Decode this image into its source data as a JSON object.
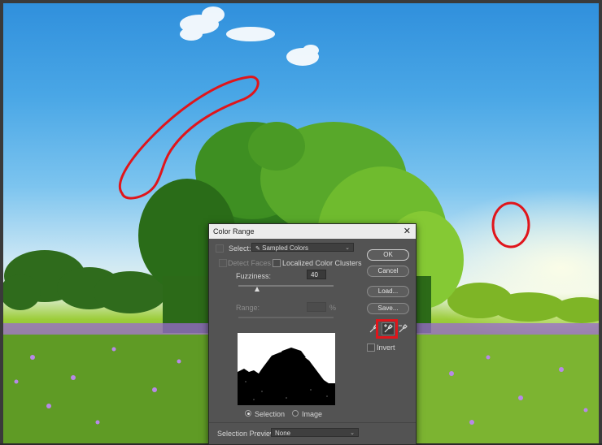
{
  "dialog": {
    "title": "Color Range",
    "close_glyph": "✕",
    "select_label": "Select:",
    "select_value": "Sampled Colors",
    "detect_faces_label": "Detect Faces",
    "localized_clusters_label": "Localized Color Clusters",
    "fuzziness_label": "Fuzziness:",
    "fuzziness_value": "40",
    "fuzziness_level": 0.2,
    "range_label": "Range:",
    "range_unit": "%",
    "selection_label": "Selection",
    "image_label": "Image",
    "preview_label": "Selection Preview:",
    "preview_value": "None",
    "buttons": {
      "ok": "OK",
      "cancel": "Cancel",
      "load": "Load...",
      "save": "Save..."
    },
    "invert_label": "Invert",
    "tools": [
      "eyedropper-icon",
      "eyedropper-plus-icon",
      "eyedropper-minus-icon"
    ]
  },
  "colors": {
    "annotation_red": "#e0151b",
    "dialog_bg": "#535353",
    "title_bar": "#ececec"
  }
}
